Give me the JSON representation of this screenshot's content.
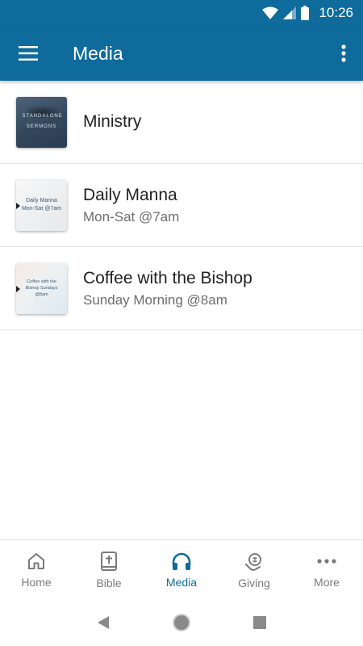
{
  "status_bar": {
    "time": "10:26"
  },
  "app_bar": {
    "title": "Media"
  },
  "media_items": [
    {
      "title": "Ministry",
      "subtitle": "",
      "thumb_text": "STANDALONE SERMONS"
    },
    {
      "title": "Daily Manna",
      "subtitle": "Mon-Sat @7am",
      "thumb_text": "Daily Manna Mon-Sat @7am"
    },
    {
      "title": "Coffee with the Bishop",
      "subtitle": "Sunday Morning @8am",
      "thumb_text": "Coffee with the Bishop Sundays @8am"
    }
  ],
  "bottom_nav": {
    "items": [
      {
        "label": "Home",
        "icon": "home-icon",
        "active": false
      },
      {
        "label": "Bible",
        "icon": "bible-icon",
        "active": false
      },
      {
        "label": "Media",
        "icon": "headphones-icon",
        "active": true
      },
      {
        "label": "Giving",
        "icon": "giving-icon",
        "active": false
      },
      {
        "label": "More",
        "icon": "more-horizontal-icon",
        "active": false
      }
    ]
  },
  "colors": {
    "primary": "#0e6b9b",
    "inactive": "#7a7a7a"
  }
}
